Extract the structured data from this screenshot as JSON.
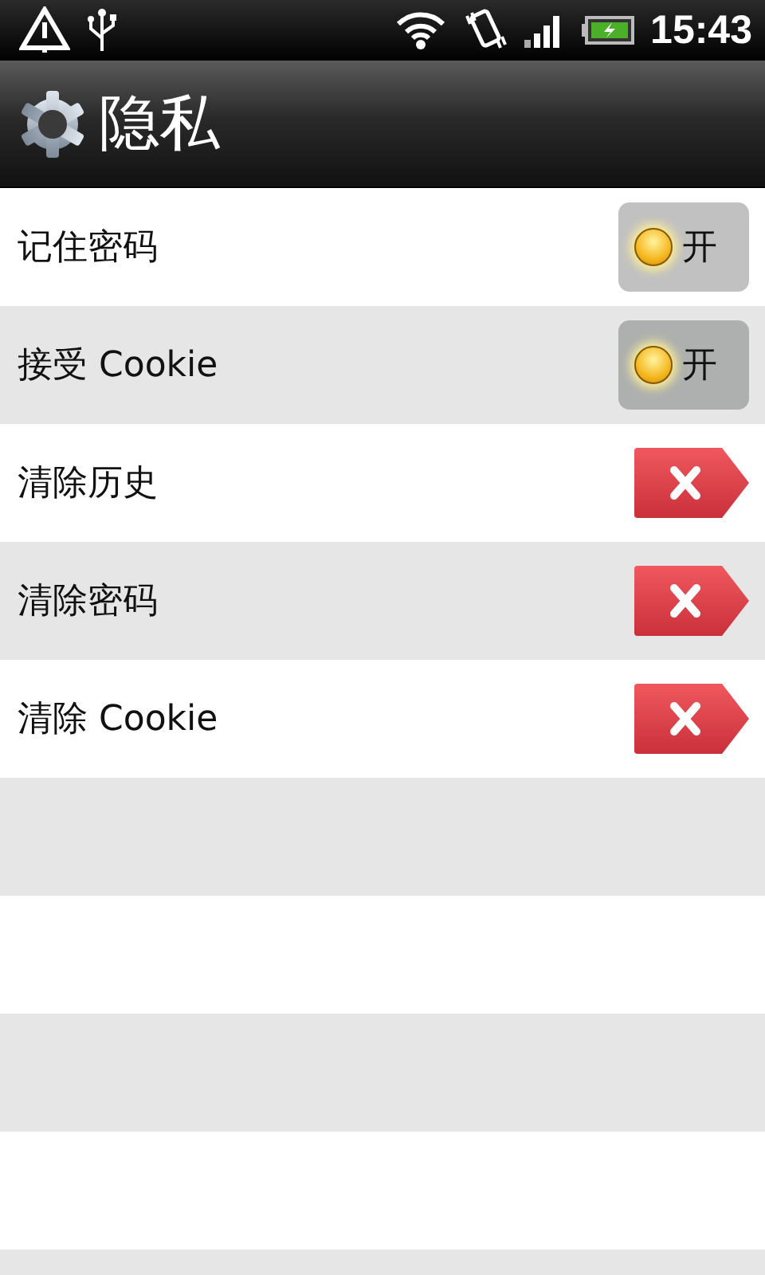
{
  "status_bar": {
    "time": "15:43"
  },
  "title_bar": {
    "title": "隐私"
  },
  "items": [
    {
      "kind": "toggle",
      "label": "记住密码",
      "on": true,
      "switch_label": "开"
    },
    {
      "kind": "toggle",
      "label": "接受 Cookie",
      "on": true,
      "switch_label": "开"
    },
    {
      "kind": "clear",
      "label": "清除历史"
    },
    {
      "kind": "clear",
      "label": "清除密码"
    },
    {
      "kind": "clear",
      "label": "清除 Cookie"
    }
  ]
}
